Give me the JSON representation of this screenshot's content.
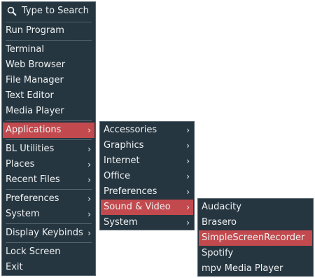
{
  "main_menu": {
    "search_placeholder": "Type to Search",
    "items": [
      {
        "label": "Run Program"
      },
      {
        "label": "Terminal"
      },
      {
        "label": "Web Browser"
      },
      {
        "label": "File Manager"
      },
      {
        "label": "Text Editor"
      },
      {
        "label": "Media Player"
      },
      {
        "label": "Applications",
        "submenu": true,
        "active": true
      },
      {
        "label": "BL Utilities",
        "submenu": true
      },
      {
        "label": "Places",
        "submenu": true
      },
      {
        "label": "Recent Files",
        "submenu": true
      },
      {
        "label": "Preferences",
        "submenu": true
      },
      {
        "label": "System",
        "submenu": true
      },
      {
        "label": "Display Keybinds",
        "submenu": true
      },
      {
        "label": "Lock Screen"
      },
      {
        "label": "Exit"
      }
    ]
  },
  "applications_menu": {
    "items": [
      {
        "label": "Accessories",
        "submenu": true
      },
      {
        "label": "Graphics",
        "submenu": true
      },
      {
        "label": "Internet",
        "submenu": true
      },
      {
        "label": "Office",
        "submenu": true
      },
      {
        "label": "Preferences",
        "submenu": true
      },
      {
        "label": "Sound & Video",
        "submenu": true,
        "active": true
      },
      {
        "label": "System",
        "submenu": true
      }
    ]
  },
  "sound_video_menu": {
    "items": [
      {
        "label": "Audacity"
      },
      {
        "label": "Brasero"
      },
      {
        "label": "SimpleScreenRecorder",
        "active": true
      },
      {
        "label": "Spotify"
      },
      {
        "label": "mpv Media Player"
      }
    ]
  },
  "arrow_glyph": "›",
  "colors": {
    "menu_bg": "#263640",
    "highlight": "#c24a4e",
    "text": "#eef1f2",
    "separator": "#56666f"
  }
}
